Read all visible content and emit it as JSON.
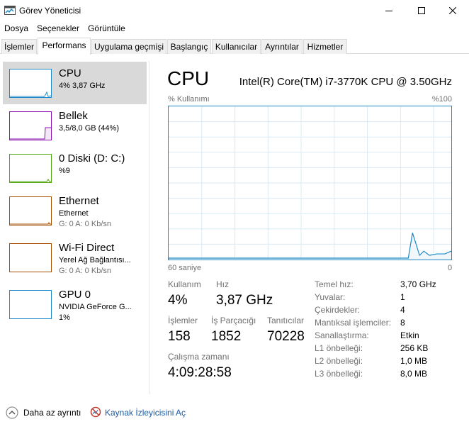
{
  "window": {
    "title": "Görev Yöneticisi"
  },
  "menu": [
    "Dosya",
    "Seçenekler",
    "Görüntüle"
  ],
  "tabs": [
    {
      "label": "İşlemler"
    },
    {
      "label": "Performans"
    },
    {
      "label": "Uygulama geçmişi"
    },
    {
      "label": "Başlangıç"
    },
    {
      "label": "Kullanıcılar"
    },
    {
      "label": "Ayrıntılar"
    },
    {
      "label": "Hizmetler"
    }
  ],
  "sidebar": {
    "items": [
      {
        "title": "CPU",
        "sub": "4% 3,87 GHz",
        "sub2": "",
        "color": "#1d89c7"
      },
      {
        "title": "Bellek",
        "sub": "3,5/8,0 GB (44%)",
        "sub2": "",
        "color": "#8b12ae"
      },
      {
        "title": "0 Diski (D: C:)",
        "sub": "%9",
        "sub2": "",
        "color": "#4da60c"
      },
      {
        "title": "Ethernet",
        "sub": "Ethernet",
        "sub2": "G: 0 A: 0 Kb/sn",
        "color": "#a74f01"
      },
      {
        "title": "Wi-Fi Direct",
        "sub": "Yerel Ağ Bağlantısı...",
        "sub2": "G: 0 A: 0 Kb/sn",
        "color": "#a74f01"
      },
      {
        "title": "GPU 0",
        "sub": "NVIDIA GeForce G...",
        "sub2": "1%",
        "color": "#1d89c7"
      }
    ]
  },
  "main": {
    "title": "CPU",
    "model": "Intel(R) Core(TM) i7-3770K CPU @ 3.50GHz",
    "graph": {
      "ylabel": "% Kullanımı",
      "ymax_label": "%100",
      "xlabel_left": "60 saniye",
      "xlabel_right": "0",
      "line_color": "#1d89c7",
      "fill_color": "#f1f6fa",
      "grid_color": "#d9eaf4"
    },
    "stats": {
      "usage_label": "Kullanım",
      "usage_value": "4%",
      "speed_label": "Hız",
      "speed_value": "3,87 GHz",
      "processes_label": "İşlemler",
      "processes_value": "158",
      "threads_label": "İş Parçacığı",
      "threads_value": "1852",
      "handles_label": "Tanıtıcılar",
      "handles_value": "70228",
      "uptime_label": "Çalışma zamanı",
      "uptime_value": "4:09:28:58"
    },
    "info": [
      {
        "label": "Temel hız:",
        "value": "3,70 GHz"
      },
      {
        "label": "Yuvalar:",
        "value": "1"
      },
      {
        "label": "Çekirdekler:",
        "value": "4"
      },
      {
        "label": "Mantıksal işlemciler:",
        "value": "8"
      },
      {
        "label": "Sanallaştırma:",
        "value": "Etkin"
      },
      {
        "label": "L1 önbelleği:",
        "value": "256 KB"
      },
      {
        "label": "L2 önbelleği:",
        "value": "1,0 MB"
      },
      {
        "label": "L3 önbelleği:",
        "value": "8,0 MB"
      }
    ]
  },
  "footer": {
    "fewer_details": "Daha az ayrıntı",
    "resource_monitor": "Kaynak İzleyicisini Aç"
  }
}
